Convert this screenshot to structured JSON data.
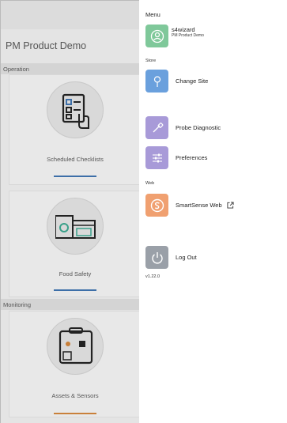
{
  "app": {
    "title": "PM Product Demo",
    "sections": {
      "operation": "Operation",
      "monitoring": "Monitoring"
    },
    "cards": {
      "scheduled": "Scheduled Checklists",
      "food_safety": "Food Safety",
      "assets": "Assets & Sensors"
    },
    "colors": {
      "bar_blue": "#3d6fa8",
      "bar_orange": "#c9803a"
    }
  },
  "drawer": {
    "header": "Menu",
    "user": {
      "name": "s4wizard",
      "org": "PM Product Demo",
      "icon": "user-icon"
    },
    "store_section": "Store",
    "web_section": "Web",
    "items": {
      "change_site": "Change Site",
      "probe_diagnostic": "Probe Diagnostic",
      "preferences": "Preferences",
      "smartsense_web": "SmartSense Web",
      "log_out": "Log Out"
    },
    "version": "v1.22.0",
    "colors": {
      "user_tile": "#7fc89a",
      "store_tile": "#6aa0dd",
      "probe_tile": "#a89ad8",
      "prefs_tile": "#a89ad8",
      "web_tile": "#f0a070",
      "logout_tile": "#9aa0a8"
    }
  }
}
